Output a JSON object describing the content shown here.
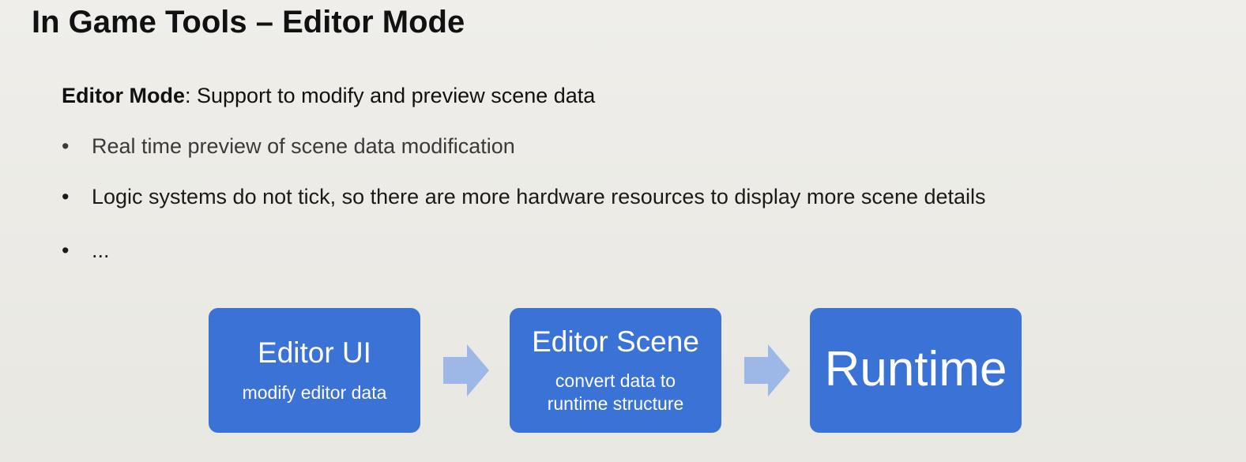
{
  "slide": {
    "title": "In Game Tools – Editor Mode",
    "lead_term": "Editor Mode",
    "lead_rest": ": Support to modify and preview scene data",
    "bullet_symbol": "•",
    "bullets": [
      "Real time preview of scene data modification",
      "Logic systems do not tick, so there are more hardware resources to display more scene details",
      "..."
    ]
  },
  "flow": {
    "box_color": "#3a72d6",
    "arrow_color": "#9db7e6",
    "steps": [
      {
        "title": "Editor UI",
        "subtitle": "modify editor data"
      },
      {
        "title": "Editor Scene",
        "subtitle_line1": "convert data to",
        "subtitle_line2": "runtime structure"
      },
      {
        "title": "Runtime"
      }
    ],
    "arrows": [
      "right-arrow-icon",
      "right-arrow-icon"
    ]
  }
}
